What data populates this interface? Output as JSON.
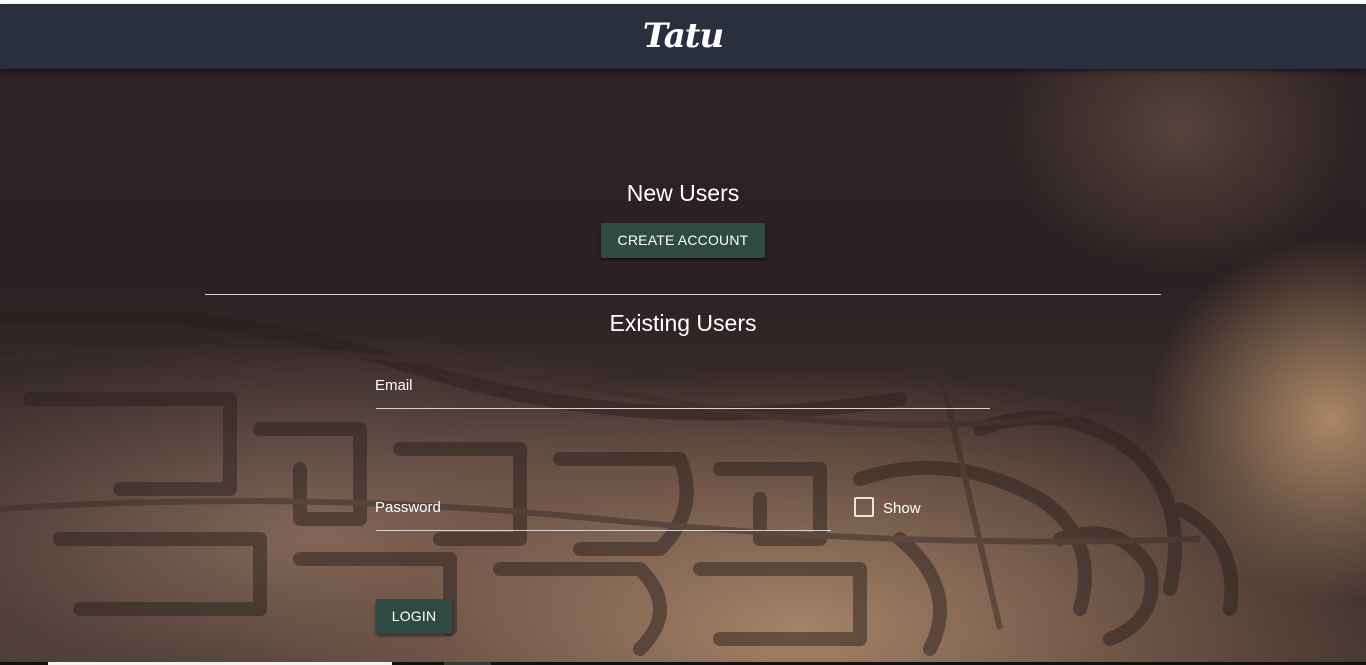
{
  "header": {
    "brand": "Tatu"
  },
  "new_users": {
    "title": "New Users",
    "create_account_label": "CREATE ACCOUNT"
  },
  "existing_users": {
    "title": "Existing Users",
    "email_label": "Email",
    "email_value": "",
    "password_label": "Password",
    "password_value": "",
    "show_label": "Show",
    "show_checked": false,
    "login_label": "LOGIN"
  },
  "colors": {
    "navbar": "#2a2f3e",
    "button": "#2e4a42",
    "text": "#ffffff"
  }
}
